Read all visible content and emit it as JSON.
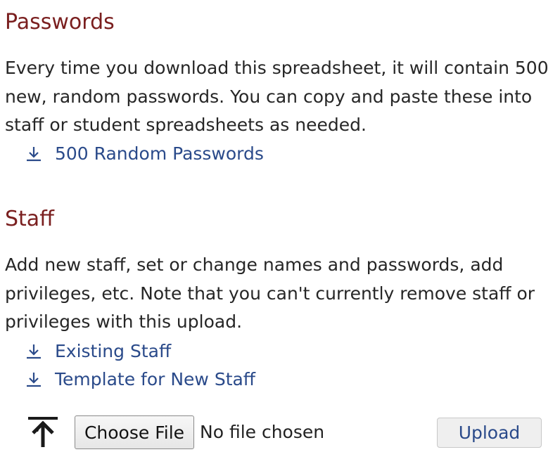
{
  "passwords": {
    "title": "Passwords",
    "description_lines": [
      "Every time you download this spreadsheet, it will contain 500",
      "new, random passwords. You can copy and paste these into",
      "staff or student spreadsheets as needed."
    ],
    "links": [
      {
        "label": "500 Random Passwords",
        "icon": "download-icon"
      }
    ]
  },
  "staff": {
    "title": "Staff",
    "description_lines": [
      "Add new staff, set or change names and passwords, add",
      "privileges, etc. Note that you can't currently remove staff or",
      "privileges with this upload."
    ],
    "links": [
      {
        "label": "Existing Staff",
        "icon": "download-icon"
      },
      {
        "label": "Template for New Staff",
        "icon": "download-icon"
      }
    ],
    "upload": {
      "icon": "upload-icon",
      "choose_file_label": "Choose File",
      "file_status": "No file chosen",
      "upload_label": "Upload"
    }
  },
  "colors": {
    "heading": "#7a1f1f",
    "link": "#2a4a8a",
    "text": "#262626"
  }
}
